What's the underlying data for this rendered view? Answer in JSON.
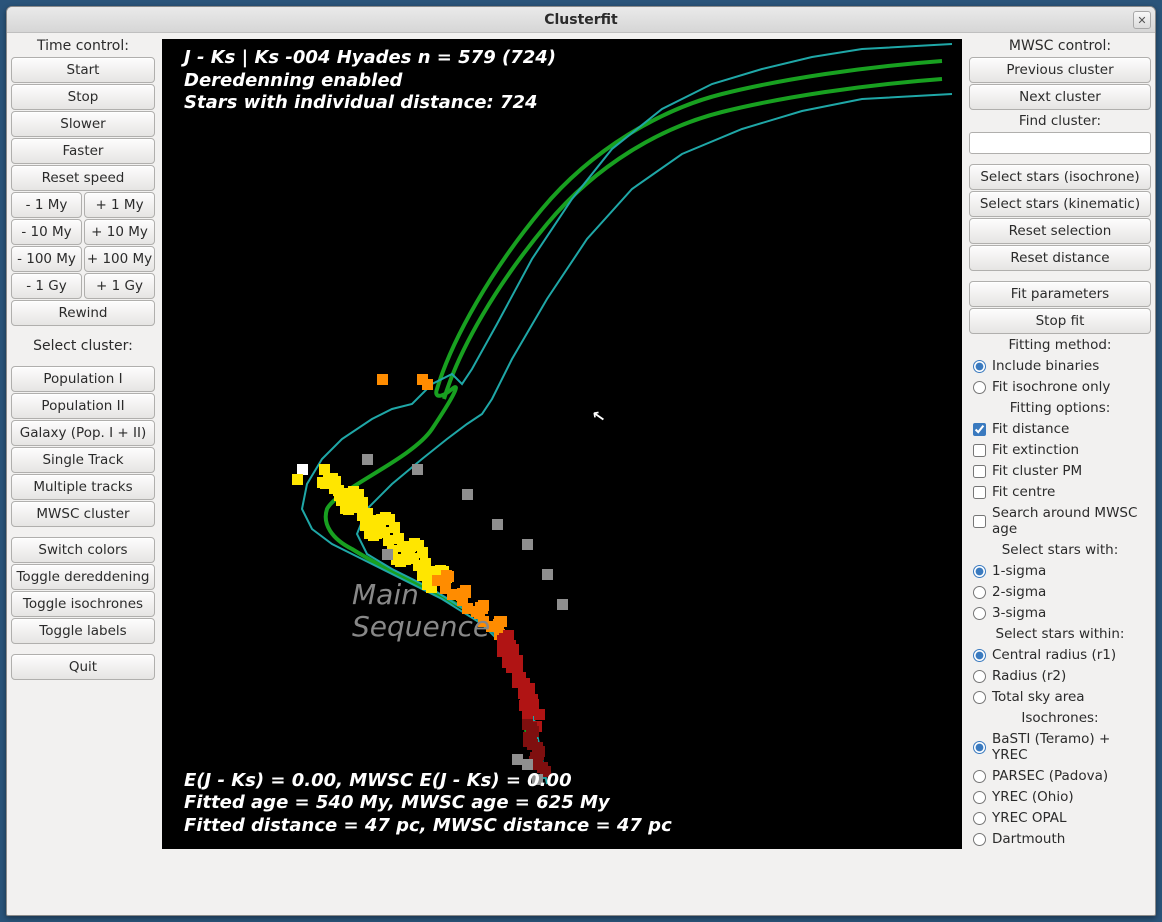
{
  "window": {
    "title": "Clusterfit"
  },
  "left": {
    "heading_time": "Time control:",
    "start": "Start",
    "stop": "Stop",
    "slower": "Slower",
    "faster": "Faster",
    "reset_speed": "Reset speed",
    "minus_1my": "- 1 My",
    "plus_1my": "+ 1 My",
    "minus_10my": "- 10 My",
    "plus_10my": "+ 10 My",
    "minus_100my": "- 100 My",
    "plus_100my": "+ 100 My",
    "minus_1gy": "- 1 Gy",
    "plus_1gy": "+ 1 Gy",
    "rewind": "Rewind",
    "heading_select": "Select cluster:",
    "pop1": "Population I",
    "pop2": "Population II",
    "galaxy": "Galaxy (Pop. I + II)",
    "single_track": "Single Track",
    "multiple_tracks": "Multiple tracks",
    "mwsc_cluster": "MWSC cluster",
    "switch_colors": "Switch colors",
    "toggle_dered": "Toggle dereddening",
    "toggle_iso": "Toggle isochrones",
    "toggle_labels": "Toggle labels",
    "quit": "Quit"
  },
  "right": {
    "heading_mwsc": "MWSC control:",
    "prev_cluster": "Previous cluster",
    "next_cluster": "Next cluster",
    "find_cluster": "Find cluster:",
    "select_iso": "Select stars (isochrone)",
    "select_kin": "Select stars (kinematic)",
    "reset_sel": "Reset selection",
    "reset_dist": "Reset distance",
    "fit_params": "Fit parameters",
    "stop_fit": "Stop fit",
    "fitting_method": "Fitting method:",
    "include_binaries": "Include binaries",
    "fit_iso_only": "Fit isochrone only",
    "fitting_options": "Fitting options:",
    "fit_distance": "Fit distance",
    "fit_extinction": "Fit extinction",
    "fit_cluster_pm": "Fit cluster PM",
    "fit_centre": "Fit centre",
    "search_mwsc_age": "Search around MWSC age",
    "select_stars_with": "Select stars with:",
    "sigma1": "1-sigma",
    "sigma2": "2-sigma",
    "sigma3": "3-sigma",
    "select_within": "Select stars within:",
    "central_radius": "Central radius (r1)",
    "radius_r2": "Radius (r2)",
    "total_sky": "Total sky area",
    "isochrones": "Isochrones:",
    "basti": "BaSTI (Teramo) + YREC",
    "parsec": "PARSEC (Padova)",
    "yrec": "YREC (Ohio)",
    "yrec_opal": "YREC OPAL",
    "dartmouth": "Dartmouth"
  },
  "plot": {
    "line1": "J - Ks | Ks  -004 Hyades  n = 579 (724)",
    "line2": "Deredenning enabled",
    "line3": "Stars with individual distance: 724",
    "ms_label1": "Main",
    "ms_label2": "Sequence",
    "bottom1": "E(J - Ks) = 0.00, MWSC E(J - Ks) = 0.00",
    "bottom2": "Fitted age = 540 My, MWSC age = 625 My",
    "bottom3": "Fitted distance = 47 pc, MWSC distance = 47 pc"
  },
  "chart_data": {
    "type": "scatter",
    "title": "J - Ks | Ks  -004 Hyades  n = 579 (724)",
    "xlabel": "J - Ks",
    "ylabel": "Ks",
    "annotations": [
      "Main Sequence"
    ],
    "overlays": [
      "isochrone (green)",
      "isochrone envelope (teal)"
    ],
    "parameters": {
      "E(J-Ks)": 0.0,
      "MWSC_E(J-Ks)": 0.0,
      "fitted_age_My": 540,
      "MWSC_age_My": 625,
      "fitted_distance_pc": 47,
      "MWSC_distance_pc": 47,
      "cluster_id": "-004",
      "cluster_name": "Hyades",
      "n_selected": 579,
      "n_total": 724
    },
    "color_legend": {
      "yellow": "bright main-sequence stars",
      "orange": "intermediate main-sequence / turnoff",
      "red": "lower main-sequence",
      "dark_red": "faint lower main-sequence",
      "grey": "non-member / unselected",
      "white": "highlighted"
    }
  }
}
